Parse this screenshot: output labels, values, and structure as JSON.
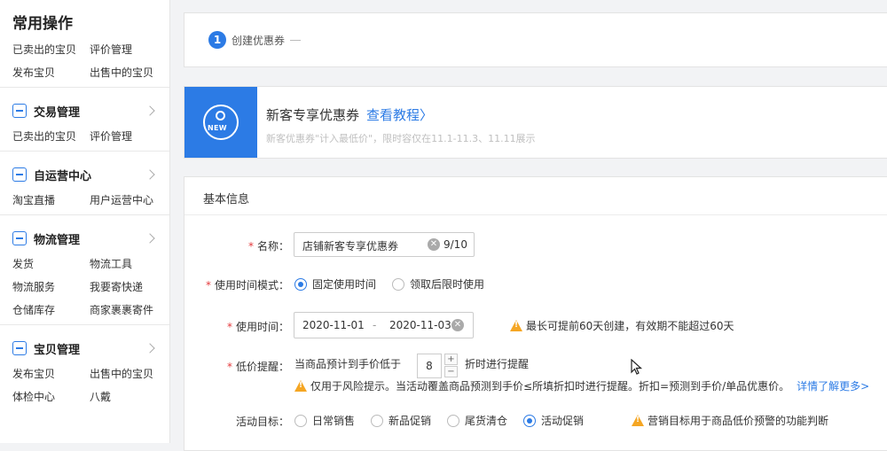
{
  "sidebar": {
    "common_title": "常用操作",
    "common_links": [
      "已卖出的宝贝",
      "评价管理",
      "发布宝贝",
      "出售中的宝贝"
    ],
    "groups": [
      {
        "icon": "document-icon",
        "title": "交易管理",
        "links": [
          "已卖出的宝贝",
          "评价管理"
        ]
      },
      {
        "icon": "chat-icon",
        "title": "自运营中心",
        "links": [
          "淘宝直播",
          "用户运营中心"
        ]
      },
      {
        "icon": "book-icon",
        "title": "物流管理",
        "links": [
          "发货",
          "物流工具",
          "物流服务",
          "我要寄快递",
          "仓储库存",
          "商家裹裹寄件"
        ]
      },
      {
        "icon": "box-icon",
        "title": "宝贝管理",
        "links": [
          "发布宝贝",
          "出售中的宝贝",
          "体检中心",
          "八戴"
        ]
      }
    ]
  },
  "steps": {
    "number": "1",
    "label": "创建优惠券"
  },
  "banner": {
    "badge_text": "NEW",
    "title": "新客专享优惠券",
    "link": "查看教程〉",
    "subtitle": "新客优惠券\"计入最低价\"，限时容仅在11.1-11.3、11.11展示"
  },
  "form": {
    "section_title": "基本信息",
    "name": {
      "label": "名称：",
      "value": "店铺新客专享优惠券",
      "counter": "9/10"
    },
    "time_mode": {
      "label": "使用时间模式：",
      "options": [
        "固定使用时间",
        "领取后限时使用"
      ],
      "selected": 0
    },
    "use_time": {
      "label": "使用时间：",
      "start": "2020-11-01",
      "sep": "-",
      "end": "2020-11-03",
      "warning": "最长可提前60天创建，有效期不能超过60天"
    },
    "low_price": {
      "label": "低价提醒：",
      "prefix": "当商品预计到手价低于",
      "value": "8",
      "suffix": "折时进行提醒",
      "warning": "仅用于风险提示。当活动覆盖商品预测到手价≤所填折扣时进行提醒。折扣=预测到手价/单品优惠价。",
      "more_link": "详情了解更多>"
    },
    "target": {
      "label": "活动目标：",
      "options": [
        "日常销售",
        "新品促销",
        "尾货清仓",
        "活动促销"
      ],
      "selected": 3,
      "warning": "营销目标用于商品低价预警的功能判断"
    }
  },
  "colors": {
    "accent": "#2c7be5",
    "required": "#e4393c",
    "warning": "#f5a623"
  }
}
